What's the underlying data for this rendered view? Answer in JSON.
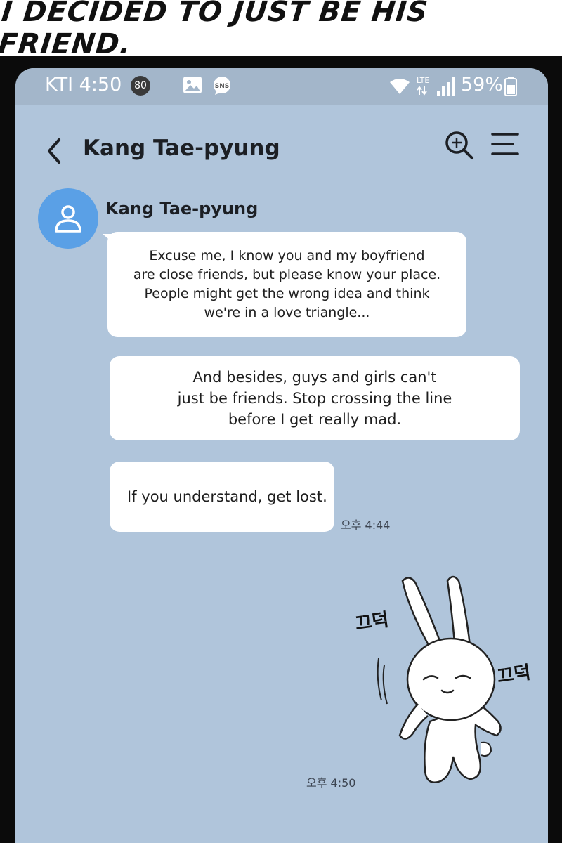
{
  "caption": {
    "text": "I DECIDED TO JUST BE HIS FRIEND."
  },
  "status_bar": {
    "carrier_time": "KTI 4:50",
    "notification_count": "80",
    "network_label": "LTE",
    "battery": "59%",
    "icons": [
      "image-icon",
      "sns-icon",
      "wifi-icon",
      "signal-icon",
      "battery-icon"
    ],
    "sns_label": "SNS"
  },
  "header": {
    "title": "Kang Tae-pyung",
    "icons": [
      "back-icon",
      "search-zoom-icon",
      "menu-icon"
    ]
  },
  "chat": {
    "sender": "Kang Tae-pyung",
    "messages": [
      {
        "text": "Excuse me, I know you and my boyfriend\nare close friends, but please know your place.\nPeople might get the wrong idea and think\nwe're in a love triangle..."
      },
      {
        "text": "And besides, guys and girls can't\njust be friends. Stop crossing the line\nbefore I get really mad."
      },
      {
        "text": "If you understand, get lost.",
        "time": "오후 4:44"
      }
    ],
    "sticker": {
      "icon": "rabbit-sticker-icon",
      "sfx_left": "끄덕",
      "sfx_right": "끄덕",
      "time": "오후 4:50"
    }
  },
  "colors": {
    "screen_bg": "#b0c5db",
    "status_bar_bg": "#a3b6ca",
    "avatar_bg": "#5aa0e6",
    "bubble_bg": "#ffffff",
    "frame": "#0b0b0b"
  }
}
